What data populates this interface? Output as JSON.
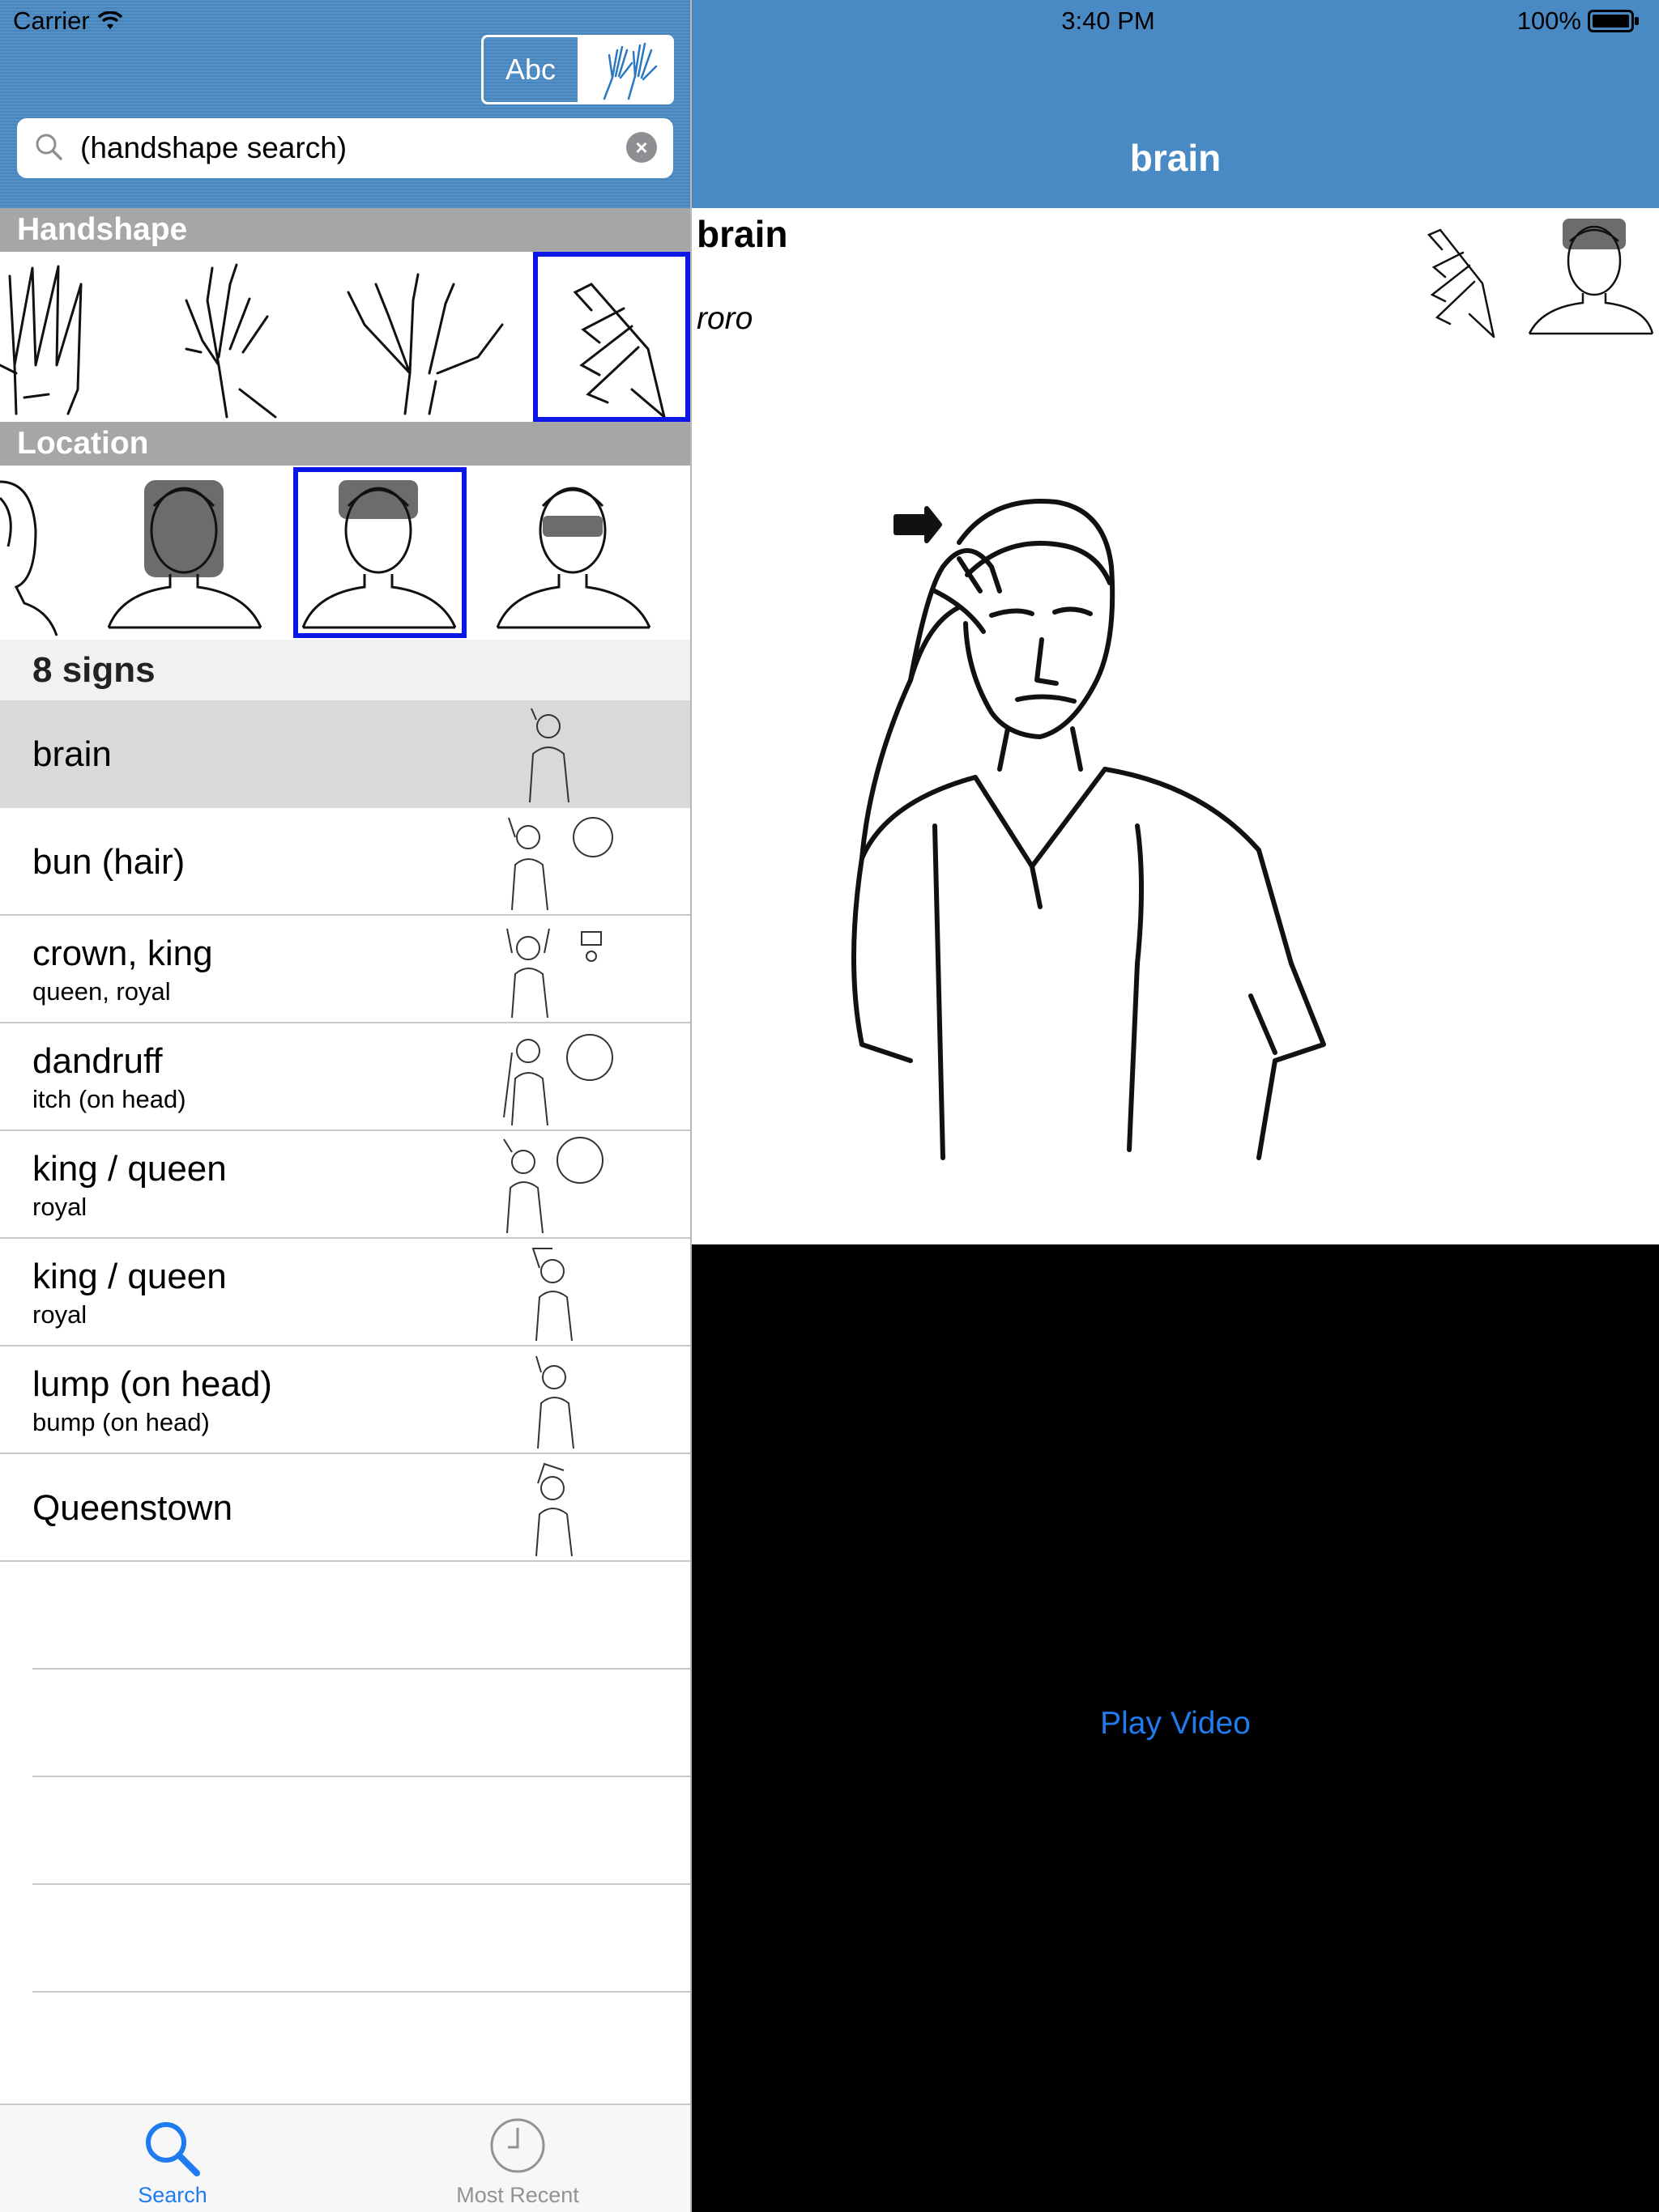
{
  "status": {
    "carrier": "Carrier",
    "time": "3:40 PM",
    "battery": "100%"
  },
  "master": {
    "mode_toggle": {
      "abc_label": "Abc",
      "selected": "handshape"
    },
    "search": {
      "placeholder": "(handshape search)",
      "value": "(handshape search)"
    },
    "handshape_section": "Handshape",
    "location_section": "Location",
    "count": "8 signs",
    "results": [
      {
        "title": "brain",
        "subtitle": "",
        "selected": true
      },
      {
        "title": "bun (hair)",
        "subtitle": ""
      },
      {
        "title": "crown, king",
        "subtitle": "queen, royal"
      },
      {
        "title": "dandruff",
        "subtitle": "itch (on head)"
      },
      {
        "title": "king / queen",
        "subtitle": "royal"
      },
      {
        "title": "king / queen",
        "subtitle": "royal"
      },
      {
        "title": "lump (on head)",
        "subtitle": "bump (on head)"
      },
      {
        "title": "Queenstown",
        "subtitle": ""
      }
    ]
  },
  "tabs": [
    {
      "label": "Search",
      "icon": "search-icon",
      "active": true,
      "color": "#1e7bf0"
    },
    {
      "label": "Most Recent",
      "icon": "clock-icon",
      "active": false,
      "color": "#929292"
    }
  ],
  "detail": {
    "nav_title": "brain",
    "gloss": "brain",
    "maori": "roro",
    "video": {
      "play_label": "Play Video"
    }
  },
  "colors": {
    "header_blue": "#4a8ac4",
    "selection_blue": "#0b17e6",
    "tint": "#1e7bf0"
  }
}
